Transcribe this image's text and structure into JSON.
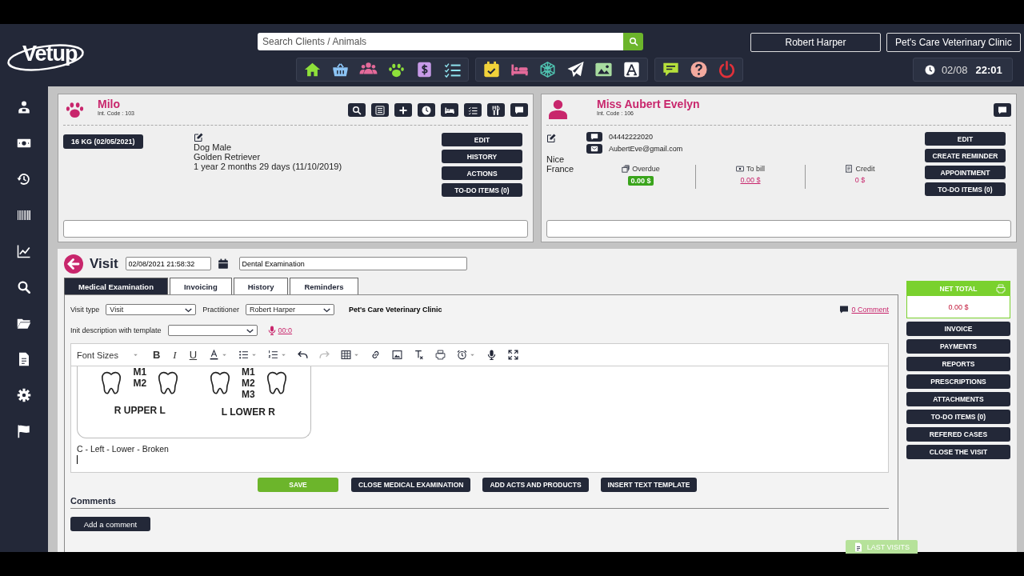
{
  "header": {
    "logo": "Vetup",
    "search": {
      "placeholder": "Search Clients / Animals"
    },
    "user": "Robert Harper",
    "clinic": "Pet's Care Veterinary Clinic",
    "date": "02/08",
    "time": "22:01"
  },
  "animal": {
    "name": "Milo",
    "code": "Int. Code : 103",
    "weight": "16 KG (02/05/2021)",
    "details": [
      "Dog Male",
      "Golden Retriever",
      "1 year 2 months 29 days (11/10/2019)"
    ],
    "buttons": [
      "EDIT",
      "HISTORY",
      "ACTIONS",
      "TO-DO ITEMS (0)"
    ]
  },
  "client": {
    "name": "Miss Aubert Evelyn",
    "code": "Int. Code : 106",
    "address": [
      "Nice",
      "France"
    ],
    "phone": "04442222020",
    "email": "AubertEve@gmail.com",
    "balances": [
      {
        "label": "Overdue",
        "value": "0.00 $",
        "kind": "badge"
      },
      {
        "label": "To bill",
        "value": "0.00 $",
        "kind": "link"
      },
      {
        "label": "Credit",
        "value": "0 $",
        "kind": "plain"
      }
    ],
    "buttons": [
      "EDIT",
      "CREATE REMINDER",
      "APPOINTMENT",
      "TO-DO ITEMS (0)"
    ]
  },
  "visit": {
    "title": "Visit",
    "date": "02/08/2021 21:58:32",
    "reason": "Dental Examination",
    "tabs": [
      {
        "label": "Medical Examination",
        "selected": true
      },
      {
        "label": "Invoicing",
        "selected": false
      },
      {
        "label": "History",
        "selected": false
      },
      {
        "label": "Reminders",
        "selected": false
      }
    ],
    "visit_type": {
      "label": "Visit type",
      "value": "Visit"
    },
    "practitioner": {
      "label": "Practitioner",
      "value": "Robert Harper"
    },
    "clinic": "Pet's Care Veterinary Clinic",
    "comment_link": "0 Comment",
    "template": {
      "label": "Init description with template"
    },
    "recording": "00:0",
    "editor": {
      "font_sizes": "Font Sizes",
      "format_buttons": [
        "B",
        "I",
        "U"
      ],
      "dental_chart": [
        {
          "molars": [
            "M1",
            "M2"
          ],
          "caption": "R UPPER L"
        },
        {
          "molars": [
            "M1",
            "M2",
            "M3"
          ],
          "caption": "L LOWER R"
        }
      ],
      "lines": [
        "C - Left - Lower - Broken"
      ]
    },
    "actions": [
      {
        "label": "SAVE",
        "kind": "primary"
      },
      {
        "label": "CLOSE MEDICAL EXAMINATION",
        "kind": "dark"
      },
      {
        "label": "ADD ACTS AND PRODUCTS",
        "kind": "dark"
      },
      {
        "label": "INSERT TEXT TEMPLATE",
        "kind": "dark"
      }
    ],
    "comments": {
      "title": "Comments",
      "button": "Add a comment"
    },
    "net_total": {
      "label": "NET TOTAL",
      "value": "0.00 $"
    },
    "side_buttons": [
      "INVOICE",
      "PAYMENTS",
      "REPORTS",
      "PRESCRIPTIONS",
      "ATTACHMENTS",
      "TO-DO ITEMS (0)",
      "REFERED CASES",
      "CLOSE THE VISIT"
    ],
    "last_visits": "LAST VISITS"
  }
}
